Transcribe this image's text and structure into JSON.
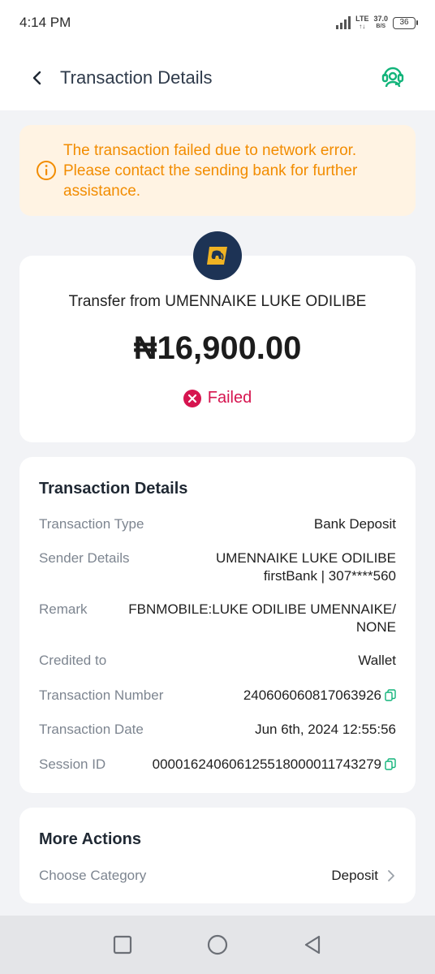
{
  "status_bar": {
    "time": "4:14 PM",
    "network": "LTE",
    "speed_value": "37.0",
    "speed_unit": "B/S",
    "battery": "36"
  },
  "header": {
    "title": "Transaction Details",
    "icons": {
      "back": "back-arrow-icon",
      "support": "headset-support-icon"
    }
  },
  "alert": {
    "text": "The transaction failed due to network error. Please contact the sending bank for further assistance.",
    "icon": "info-icon",
    "color": "#f28c00"
  },
  "summary": {
    "transfer_from": "Transfer from UMENNAIKE LUKE ODILIBE",
    "amount": "₦16,900.00",
    "status": "Failed",
    "status_color": "#d6144f",
    "bank_logo": "firstbank-elephant-logo"
  },
  "details": {
    "title": "Transaction Details",
    "rows": [
      {
        "label": "Transaction Type",
        "value": "Bank Deposit"
      },
      {
        "label": "Sender Details",
        "value_line1": "UMENNAIKE LUKE ODILIBE",
        "value_line2": "firstBank | 307****560"
      },
      {
        "label": "Remark",
        "value_line1": "FBNMOBILE:LUKE ODILIBE UMENNAIKE/",
        "value_line2": "NONE"
      },
      {
        "label": "Credited to",
        "value": "Wallet"
      },
      {
        "label": "Transaction Number",
        "value": "240606060817063926"
      },
      {
        "label": "Transaction Date",
        "value": "Jun 6th, 2024 12:55:56"
      },
      {
        "label": "Session ID",
        "value": "000016240606125518000011743279"
      }
    ]
  },
  "more_actions": {
    "title": "More Actions",
    "category_label": "Choose Category",
    "category_value": "Deposit"
  },
  "nav": {
    "icons": [
      "recents-square-icon",
      "home-circle-icon",
      "back-triangle-icon"
    ]
  },
  "colors": {
    "accent": "#12b47a",
    "background": "#f2f3f6"
  }
}
